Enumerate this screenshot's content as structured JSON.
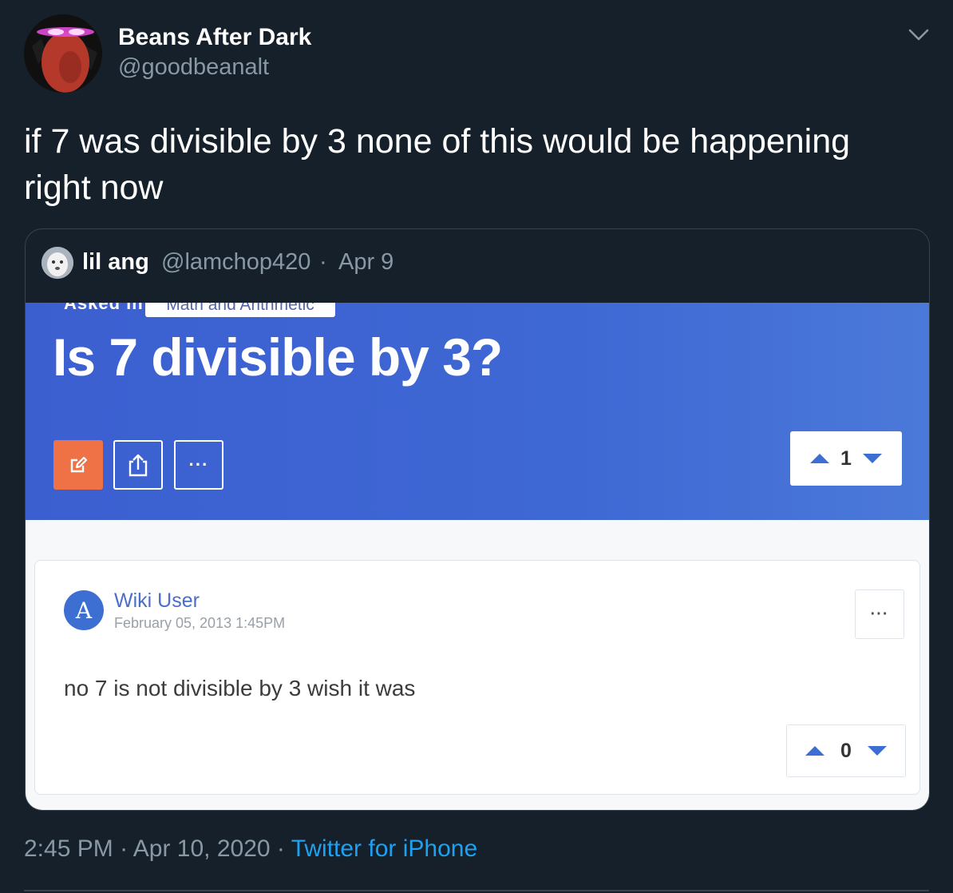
{
  "tweet": {
    "author_name": "Beans After Dark",
    "author_handle": "@goodbeanalt",
    "text": "if 7 was divisible by 3 none of this would be happening right now",
    "time": "2:45 PM",
    "date": "Apr 10, 2020",
    "client": "Twitter for iPhone",
    "separator": "·"
  },
  "quoted_tweet": {
    "author_name": "lil ang",
    "author_handle": "@lamchop420",
    "separator": "·",
    "date": "Apr 9",
    "image": {
      "asked_in_label": "Asked in",
      "category": "Math and Arithmetic",
      "question": "Is 7 divisible by 3?",
      "question_votes": "1",
      "more_label": "···",
      "answer": {
        "avatar_letter": "A",
        "author": "Wiki User",
        "date": "February 05, 2013 1:45PM",
        "text": "no 7 is not divisible by 3 wish it was",
        "votes": "0",
        "more_label": "···"
      }
    }
  },
  "colors": {
    "background": "#15202b",
    "secondary_text": "#8899a6",
    "link": "#1da1f2",
    "banner_blue": "#3e68d4",
    "edit_orange": "#ee7246",
    "vote_arrow_blue": "#3d6fd3"
  },
  "icons": [
    "chevron-down-icon",
    "edit-icon",
    "share-icon",
    "upvote-icon",
    "downvote-icon"
  ]
}
